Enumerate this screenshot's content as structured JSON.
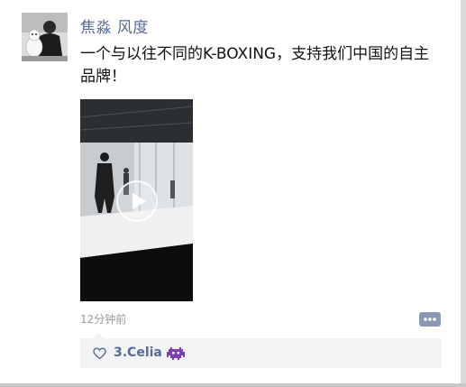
{
  "post": {
    "username": "焦淼 风度",
    "text": "一个与以往不同的K-BOXING，支持我们中国的自主品牌！",
    "time": "12分钟前",
    "avatar_icon": "avatar-photo",
    "video_icon": "play-icon",
    "comment_icon": "comment-icon"
  },
  "likes": {
    "icon": "heart-icon",
    "names": [
      "3.Celia"
    ],
    "emoji": "alien-monster-emoji"
  },
  "colors": {
    "name_blue": "#586b95",
    "time_gray": "#9a9a9a",
    "likes_bg": "#f3f3f5"
  }
}
